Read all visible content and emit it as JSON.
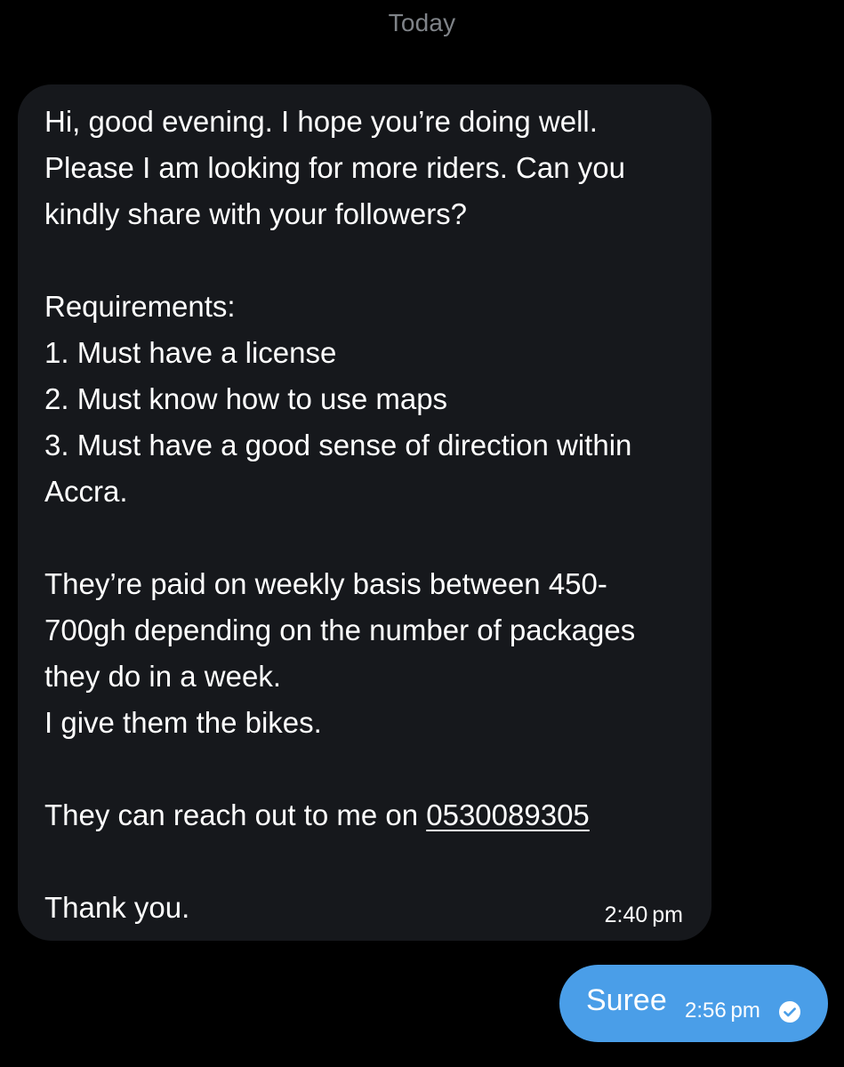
{
  "date_separator": "Today",
  "incoming_message": {
    "lines": {
      "p1": "Hi, good evening. I hope you’re doing well. Please I am looking for more riders. Can you kindly share with your followers?",
      "req_title": "Requirements:",
      "req1": "1. Must have a license",
      "req2": "2. Must know how to use maps",
      "req3": "3. Must have a good sense of direction within Accra.",
      "p3": "They’re paid on weekly basis between 450-700gh depending on the number of packages they do in a week.",
      "p4": "I give them the bikes.",
      "contact_prefix": "They can reach out to me on ",
      "phone": "0530089305",
      "closing": "Thank you."
    },
    "timestamp": "2:40 pm"
  },
  "outgoing_message": {
    "text": "Suree",
    "timestamp": "2:56 pm",
    "status_icon": "check-circle-icon"
  },
  "colors": {
    "background": "#000000",
    "incoming_bubble": "#16181c",
    "outgoing_bubble": "#4a9ee8",
    "muted_text": "#7f8388"
  }
}
